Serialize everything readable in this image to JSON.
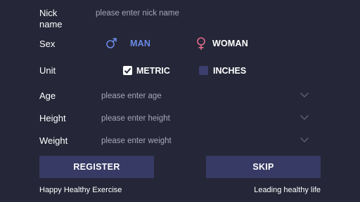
{
  "form": {
    "nickname": {
      "label": "Nick name",
      "placeholder": "please enter nick name"
    },
    "sex": {
      "label": "Sex",
      "options": [
        {
          "label": "MAN",
          "icon": "male-icon",
          "selected": true,
          "color": "#6b8ae6"
        },
        {
          "label": "WOMAN",
          "icon": "female-icon",
          "selected": false,
          "color": "#e06d8d"
        }
      ]
    },
    "unit": {
      "label": "Unit",
      "options": [
        {
          "label": "METRIC",
          "checked": true
        },
        {
          "label": "INCHES",
          "checked": false
        }
      ]
    },
    "age": {
      "label": "Age",
      "placeholder": "please enter age"
    },
    "height": {
      "label": "Height",
      "placeholder": "please enter height"
    },
    "weight": {
      "label": "Weight",
      "placeholder": "please enter weight"
    }
  },
  "actions": {
    "register_label": "REGISTER",
    "skip_label": "SKIP"
  },
  "footer": {
    "left": "Happy Healthy Exercise",
    "right": "Leading healthy life"
  },
  "colors": {
    "background": "#252637",
    "button": "#363a64",
    "accent_male": "#6b8ae6",
    "accent_female": "#e06d8d",
    "placeholder": "#a7a8b6"
  }
}
